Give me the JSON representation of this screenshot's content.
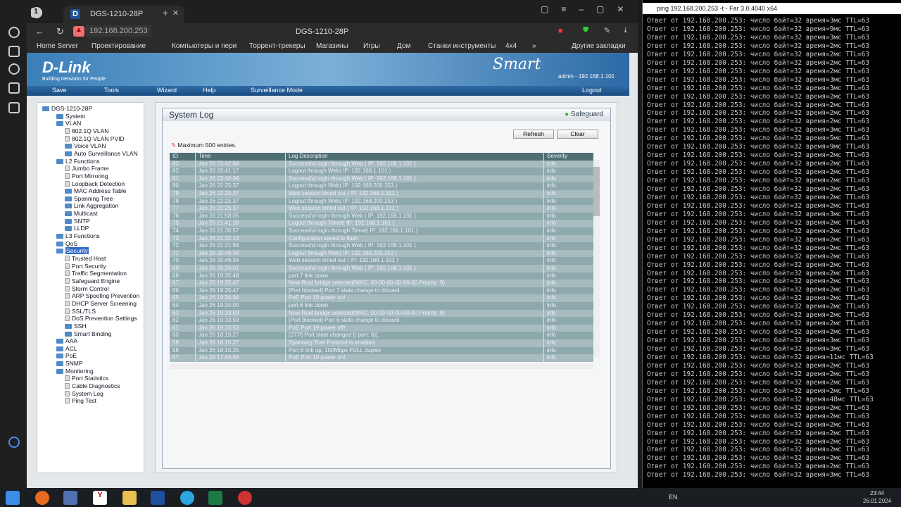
{
  "browser": {
    "tab_count": "1",
    "tab_title": "DGS-1210-28P",
    "url": "192.168.200.253",
    "page_title": "DGS-1210-28P",
    "bookmarks": [
      "Home Server",
      "Проектирование",
      "Компьютеры и пери",
      "Торрент-трекеры",
      "Магазины",
      "Игры",
      "Дом",
      "Станки инструменты",
      "4x4",
      "»"
    ],
    "other_bookmarks": "Другие закладки"
  },
  "header": {
    "logo": "D-Link",
    "tagline": "Building Networks for People",
    "brand": "Smart",
    "user": "admin - 192.168.1.101"
  },
  "menu": {
    "save": "Save",
    "tools": "Tools",
    "wizard": "Wizard",
    "help": "Help",
    "surveillance": "Surveillance Mode",
    "logout": "Logout"
  },
  "tree": [
    {
      "label": "DGS-1210-28P",
      "lvl": 0
    },
    {
      "label": "System",
      "lvl": 1
    },
    {
      "label": "VLAN",
      "lvl": 1
    },
    {
      "label": "802.1Q VLAN",
      "lvl": 2,
      "file": true
    },
    {
      "label": "802.1Q VLAN PVID",
      "lvl": 2,
      "file": true
    },
    {
      "label": "Voice VLAN",
      "lvl": 2
    },
    {
      "label": "Auto Surveillance VLAN",
      "lvl": 2
    },
    {
      "label": "L2 Functions",
      "lvl": 1
    },
    {
      "label": "Jumbo Frame",
      "lvl": 2,
      "file": true
    },
    {
      "label": "Port Mirroring",
      "lvl": 2,
      "file": true
    },
    {
      "label": "Loopback Detection",
      "lvl": 2,
      "file": true
    },
    {
      "label": "MAC Address Table",
      "lvl": 2
    },
    {
      "label": "Spanning Tree",
      "lvl": 2
    },
    {
      "label": "Link Aggregation",
      "lvl": 2
    },
    {
      "label": "Multicast",
      "lvl": 2
    },
    {
      "label": "SNTP",
      "lvl": 2
    },
    {
      "label": "LLDP",
      "lvl": 2
    },
    {
      "label": "L3 Functions",
      "lvl": 1
    },
    {
      "label": "QoS",
      "lvl": 1
    },
    {
      "label": "Security",
      "lvl": 1,
      "selected": true
    },
    {
      "label": "Trusted Host",
      "lvl": 2,
      "file": true
    },
    {
      "label": "Port Security",
      "lvl": 2,
      "file": true
    },
    {
      "label": "Traffic Segmentation",
      "lvl": 2,
      "file": true
    },
    {
      "label": "Safeguard Engine",
      "lvl": 2,
      "file": true
    },
    {
      "label": "Storm Control",
      "lvl": 2,
      "file": true
    },
    {
      "label": "ARP Spoofing Prevention",
      "lvl": 2,
      "file": true
    },
    {
      "label": "DHCP Server Screening",
      "lvl": 2,
      "file": true
    },
    {
      "label": "SSL/TLS",
      "lvl": 2,
      "file": true
    },
    {
      "label": "DoS Prevention Settings",
      "lvl": 2,
      "file": true
    },
    {
      "label": "SSH",
      "lvl": 2
    },
    {
      "label": "Smart Binding",
      "lvl": 2
    },
    {
      "label": "AAA",
      "lvl": 1
    },
    {
      "label": "ACL",
      "lvl": 1
    },
    {
      "label": "PoE",
      "lvl": 1
    },
    {
      "label": "SNMP",
      "lvl": 1
    },
    {
      "label": "Monitoring",
      "lvl": 1
    },
    {
      "label": "Port Statistics",
      "lvl": 2,
      "file": true
    },
    {
      "label": "Cable Diagnostics",
      "lvl": 2,
      "file": true
    },
    {
      "label": "System Log",
      "lvl": 2,
      "file": true
    },
    {
      "label": "Ping Test",
      "lvl": 2,
      "file": true
    }
  ],
  "syslog": {
    "title": "System Log",
    "safeguard": "Safeguard",
    "refresh": "Refresh",
    "clear": "Clear",
    "note": "Maximum 500 entries.",
    "columns": [
      "ID",
      "Time",
      "Log Description",
      "Severity"
    ],
    "rows": [
      [
        "83",
        "Jan 26 23:42:04",
        "Successful login through Web ( IP: 192.168.1.101 )",
        "info"
      ],
      [
        "82",
        "Jan 26 23:41:17",
        "Logout through Web( IP: 192.168.1.101 )",
        "info"
      ],
      [
        "81",
        "Jan 26 23:40:09",
        "Successful login through Web ( IP: 192.168.1.101 )",
        "info"
      ],
      [
        "80",
        "Jan 26 22:25:37",
        "Logout through Web( IP: 192.168.200.253 )",
        "info"
      ],
      [
        "79",
        "Jan 26 22:25:37",
        "Web session timed out ( IP: 192.168.1.101 )",
        "info"
      ],
      [
        "78",
        "Jan 26 22:25:37",
        "Logout through Web( IP: 192.168.200.253 )",
        "info"
      ],
      [
        "77",
        "Jan 26 22:25:37",
        "Web session timed out ( IP: 192.168.1.101 )",
        "info"
      ],
      [
        "76",
        "Jan 26 21:58:05",
        "Successful login through Web ( IP: 192.168.1.101 )",
        "info"
      ],
      [
        "75",
        "Jan 26 21:41:39",
        "Logout through Telnet( IP: 192.168.1.101 )",
        "info"
      ],
      [
        "74",
        "Jan 26 21:36:57",
        "Successful login through Telnet( IP: 192.168.1.101 )",
        "info"
      ],
      [
        "73",
        "Jan 26 21:32:13",
        "Configuration saved to flash",
        "info"
      ],
      [
        "72",
        "Jan 26 21:21:56",
        "Successful login through Web ( IP: 192.168.1.101 )",
        "info"
      ],
      [
        "71",
        "Jan 26 20:46:34",
        "Logout through Web( IP: 192.168.200.253 )",
        "info"
      ],
      [
        "70",
        "Jan 26 20:46:34",
        "Web session timed out ( IP: 192.168.1.101 )",
        "info"
      ],
      [
        "69",
        "Jan 26 20:26:01",
        "Successful login through Web ( IP: 192.168.1.101 )",
        "info"
      ],
      [
        "68",
        "Jan 26 19:35:48",
        "port 7 link down",
        "info"
      ],
      [
        "67",
        "Jan 26 19:35:47",
        "New Root bridge selected(MAC: 00-00-00-00-00-00 Priority :0)",
        "info"
      ],
      [
        "66",
        "Jan 26 19:35:47",
        "[Port blocked] Port 7 state change to discard.",
        "info"
      ],
      [
        "65",
        "Jan 26 19:34:04",
        "PoE Port 19 power on!",
        "info"
      ],
      [
        "64",
        "Jan 26 19:34:00",
        "port 6 link down",
        "info"
      ],
      [
        "63",
        "Jan 26 19:33:59",
        "New Root bridge selected(MAC: 00-00-00-00-00-00 Priority :0)",
        "info"
      ],
      [
        "62",
        "Jan 26 19:33:59",
        "[Port blocked] Port 6 state change to discard.",
        "info"
      ],
      [
        "61",
        "Jan 26 19:33:53",
        "PoE Port 19 power off!",
        "info"
      ],
      [
        "60",
        "Jan 26 18:15:27",
        "[STP] Port state changed [( port: 6)].",
        "info"
      ],
      [
        "59",
        "Jan 26 18:15:27",
        "Spanning Tree Protocol is enabled",
        "info"
      ],
      [
        "58",
        "Jan 26 18:15:25",
        "Port 6 link up, 100Mbps FULL duplex",
        "info"
      ],
      [
        "57",
        "Jan 26 17:56:56",
        "PoE Port 19 power on!",
        "info"
      ]
    ]
  },
  "console": {
    "title": "ping 192.168.200.253 -t - Far 3.0.4040 x64",
    "prefix": "Ответ от 192.168.200.253: число байт=32 время=",
    "suffix": "мс TTL=63",
    "times": [
      3,
      9,
      3,
      2,
      2,
      2,
      2,
      3,
      3,
      2,
      2,
      2,
      2,
      3,
      5,
      9,
      2,
      2,
      2,
      2,
      2,
      2,
      2,
      3,
      2,
      2,
      2,
      2,
      2,
      2,
      2,
      2,
      2,
      2,
      2,
      2,
      2,
      2,
      3,
      3,
      11,
      2,
      2,
      2,
      2,
      48,
      2,
      2,
      2,
      2,
      2,
      2,
      2,
      2,
      3
    ]
  },
  "tray": {
    "lang": "EN",
    "time": "23:44",
    "date": "26.01.2024"
  }
}
